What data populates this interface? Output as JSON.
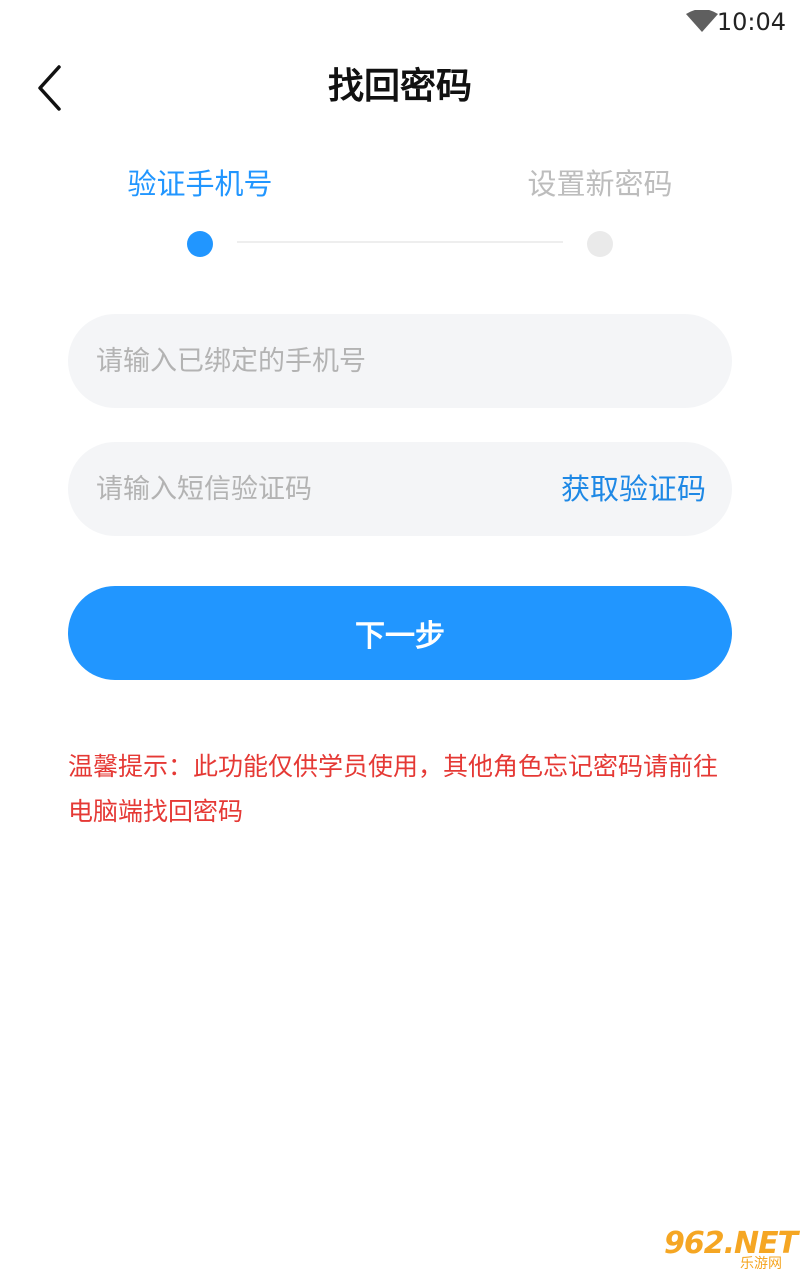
{
  "status_bar": {
    "time": "10:04"
  },
  "header": {
    "title": "找回密码",
    "back_icon": "chevron-left-icon"
  },
  "steps": [
    {
      "label": "验证手机号",
      "active": true
    },
    {
      "label": "设置新密码",
      "active": false
    }
  ],
  "form": {
    "phone_placeholder": "请输入已绑定的手机号",
    "phone_value": "",
    "code_placeholder": "请输入短信验证码",
    "code_value": "",
    "get_code_label": "获取验证码",
    "next_label": "下一步"
  },
  "tip": "温馨提示：此功能仅供学员使用，其他角色忘记密码请前往电脑端找回密码",
  "watermark": {
    "main": "962.NET",
    "sub": "乐游网"
  },
  "colors": {
    "primary": "#2196ff",
    "link": "#1e88e5",
    "inactive_text": "#bdbdbd",
    "inactive_dot": "#eaeaea",
    "tip": "#e53935"
  }
}
